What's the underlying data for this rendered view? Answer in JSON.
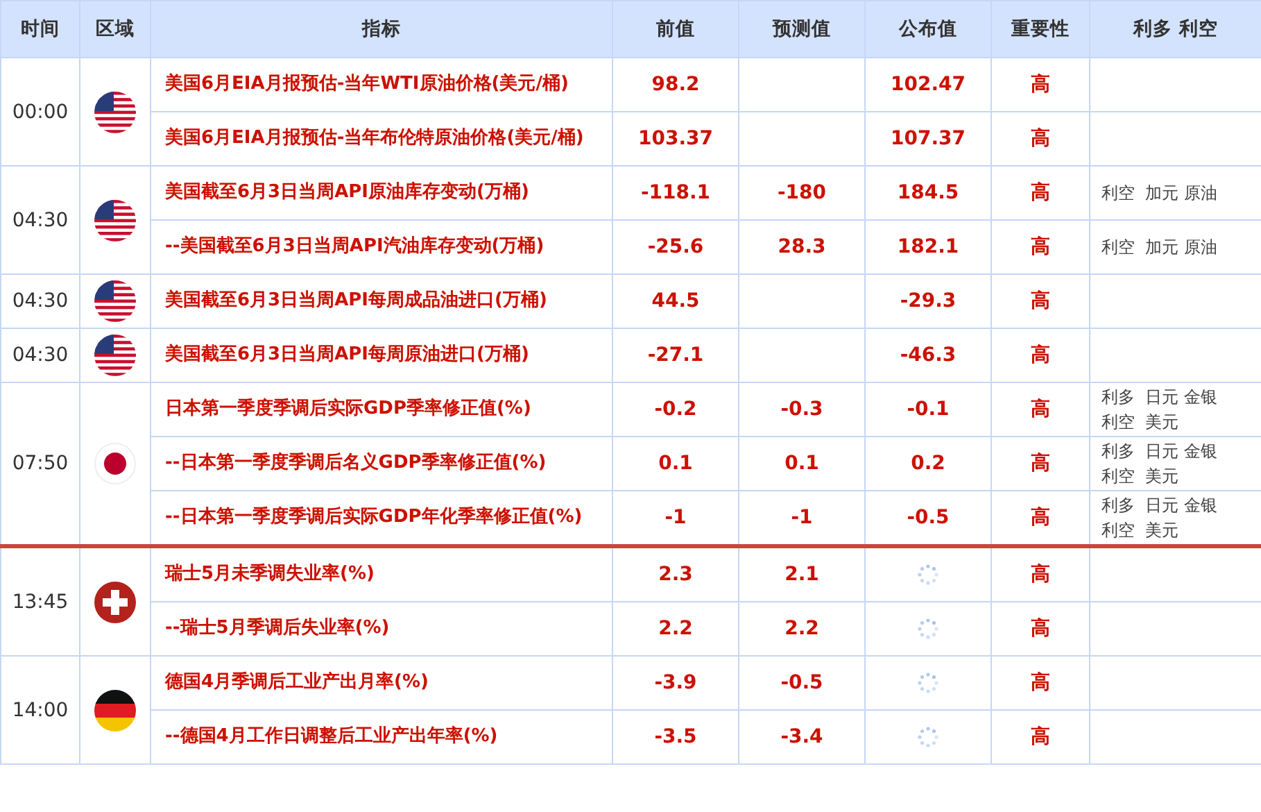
{
  "columns": [
    "时间",
    "区域",
    "指标",
    "前值",
    "预测值",
    "公布值",
    "重要性",
    "利多 利空"
  ],
  "groups": [
    {
      "time": "00:00",
      "kind": "us",
      "now_line": false,
      "items": [
        {
          "indicator": "美国6月EIA月报预估-当年WTI原油价格(美元/桶)",
          "previous": "98.2",
          "actual": "102.47",
          "published": true,
          "importance": "高"
        },
        {
          "indicator": "美国6月EIA月报预估-当年布伦特原油价格(美元/桶)",
          "previous": "103.37",
          "actual": "107.37",
          "published": true,
          "importance": "高"
        }
      ]
    },
    {
      "time": "04:30",
      "kind": "us",
      "now_line": false,
      "items": [
        {
          "indicator": "美国截至6月3日当周API原油库存变动(万桶)",
          "previous": "-118.1",
          "forecast": "-180",
          "actual": "184.5",
          "published": true,
          "importance": "高",
          "impact": [
            "利空  加元 原油"
          ]
        },
        {
          "indicator": "--美国截至6月3日当周API汽油库存变动(万桶)",
          "previous": "-25.6",
          "forecast": "28.3",
          "actual": "182.1",
          "published": true,
          "importance": "高",
          "impact": [
            "利空  加元 原油"
          ]
        }
      ]
    },
    {
      "time": "04:30",
      "kind": "us",
      "now_line": false,
      "items": [
        {
          "indicator": "美国截至6月3日当周API每周成品油进口(万桶)",
          "previous": "44.5",
          "actual": "-29.3",
          "published": true,
          "importance": "高"
        }
      ]
    },
    {
      "time": "04:30",
      "kind": "us",
      "now_line": false,
      "items": [
        {
          "indicator": "美国截至6月3日当周API每周原油进口(万桶)",
          "previous": "-27.1",
          "actual": "-46.3",
          "published": true,
          "importance": "高"
        }
      ]
    },
    {
      "time": "07:50",
      "kind": "jp",
      "now_line": false,
      "items": [
        {
          "indicator": "日本第一季度季调后实际GDP季率修正值(%)",
          "previous": "-0.2",
          "forecast": "-0.3",
          "actual": "-0.1",
          "published": true,
          "importance": "高",
          "impact": [
            "利多  日元 金银",
            "利空  美元"
          ]
        },
        {
          "indicator": "--日本第一季度季调后名义GDP季率修正值(%)",
          "previous": "0.1",
          "forecast": "0.1",
          "actual": "0.2",
          "published": true,
          "importance": "高",
          "impact": [
            "利多  日元 金银",
            "利空  美元"
          ]
        },
        {
          "indicator": "--日本第一季度季调后实际GDP年化季率修正值(%)",
          "previous": "-1",
          "forecast": "-1",
          "actual": "-0.5",
          "published": true,
          "importance": "高",
          "impact": [
            "利多  日元 金银",
            "利空  美元"
          ]
        }
      ]
    },
    {
      "time": "13:45",
      "kind": "ch",
      "now_line": true,
      "items": [
        {
          "indicator": "瑞士5月未季调失业率(%)",
          "previous": "2.3",
          "forecast": "2.1",
          "published": false,
          "importance": "高"
        },
        {
          "indicator": "--瑞士5月季调后失业率(%)",
          "previous": "2.2",
          "forecast": "2.2",
          "published": false,
          "importance": "高"
        }
      ]
    },
    {
      "time": "14:00",
      "kind": "de",
      "now_line": false,
      "items": [
        {
          "indicator": "德国4月季调后工业产出月率(%)",
          "previous": "-3.9",
          "forecast": "-0.5",
          "published": false,
          "importance": "高"
        },
        {
          "indicator": "--德国4月工作日调整后工业产出年率(%)",
          "previous": "-3.5",
          "forecast": "-3.4",
          "published": false,
          "importance": "高"
        }
      ]
    }
  ]
}
